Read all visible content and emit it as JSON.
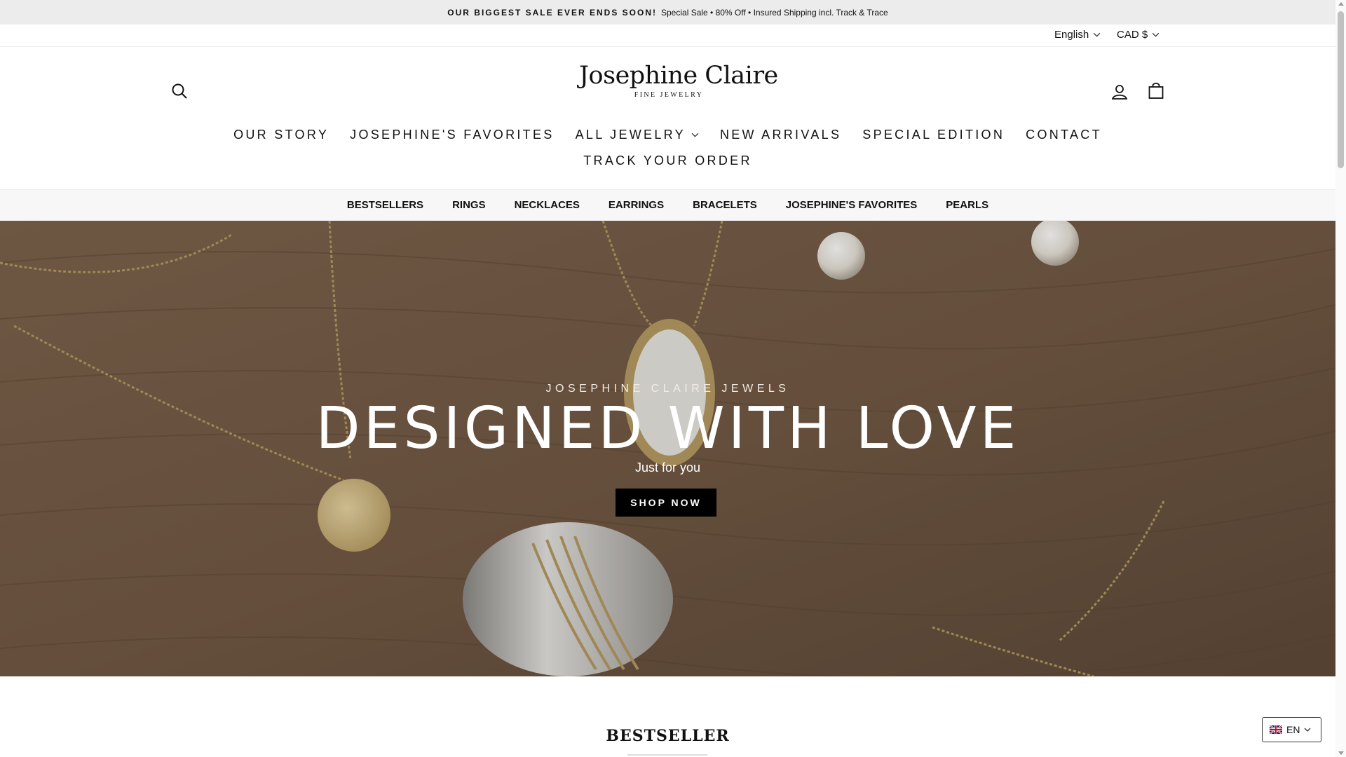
{
  "announcement": {
    "bold": "OUR BIGGEST SALE EVER ENDS SOON!",
    "text": "Special Sale • 80% Off • Insured Shipping incl. Track & Trace"
  },
  "utility": {
    "language": "English",
    "currency": "CAD $"
  },
  "logo": {
    "name": "Josephine Claire",
    "tagline": "FINE JEWELRY"
  },
  "main_nav": {
    "row1": [
      "OUR STORY",
      "JOSEPHINE'S FAVORITES",
      "ALL JEWELRY",
      "NEW ARRIVALS",
      "SPECIAL EDITION",
      "CONTACT"
    ],
    "row2": [
      "TRACK YOUR ORDER"
    ]
  },
  "sub_nav": [
    "BESTSELLERS",
    "RINGS",
    "NECKLACES",
    "EARRINGS",
    "BRACELETS",
    "JOSEPHINE'S FAVORITES",
    "PEARLS"
  ],
  "hero": {
    "kicker": "JOSEPHINE CLAIRE JEWELS",
    "title": "DESIGNED WITH LOVE",
    "subtitle": "Just for you",
    "cta": "SHOP NOW"
  },
  "section": {
    "title": "BESTSELLER"
  },
  "lang_widget": {
    "code": "EN"
  },
  "colors": {
    "announcement_bg": "#ececec",
    "hero_wood": "#745a45",
    "button_bg": "#000000"
  },
  "icons": {
    "search": "search-icon",
    "account": "user-icon",
    "cart": "bag-icon",
    "chevron": "chevron-down-icon",
    "flag": "uk-flag-icon"
  }
}
